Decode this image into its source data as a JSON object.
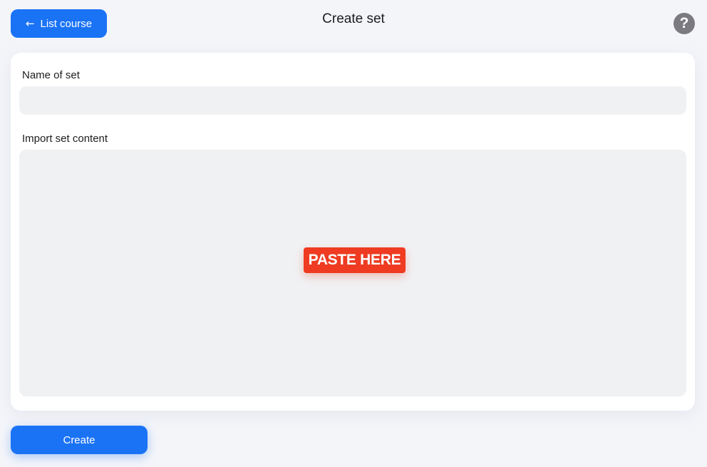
{
  "header": {
    "back_button": {
      "icon": "arrow-left-icon",
      "icon_glyph": "←",
      "label": "List course"
    },
    "title": "Create set",
    "help_button": {
      "icon": "question-mark-icon",
      "glyph": "?"
    }
  },
  "form": {
    "name_field": {
      "label": "Name of set",
      "value": "",
      "placeholder": ""
    },
    "import_field": {
      "label": "Import set content",
      "badge": "PASTE HERE"
    }
  },
  "actions": {
    "create_label": "Create"
  },
  "colors": {
    "accent": "#1a73f5",
    "paste_badge": "#ee3b22",
    "help_icon": "#7a7a80",
    "field_background": "#f0f1f3",
    "page_background": "#f4f5f9"
  }
}
